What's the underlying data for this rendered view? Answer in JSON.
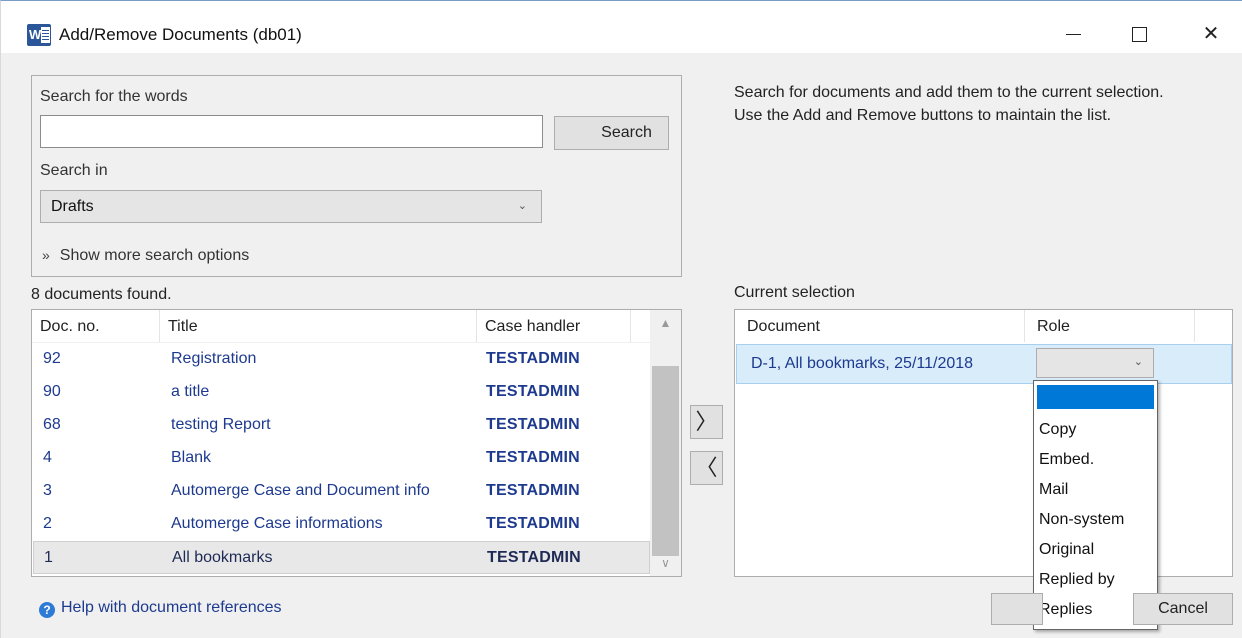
{
  "window": {
    "title": "Add/Remove Documents (db01)",
    "controls": {
      "minimize": "minimize",
      "maximize": "maximize",
      "close": "✕"
    }
  },
  "search": {
    "words_label": "Search for the words",
    "words_value": "",
    "search_button": "Search",
    "search_in_label": "Search in",
    "search_in_value": "Drafts",
    "more_options": "Show more search options"
  },
  "results": {
    "count_text": "8 documents found.",
    "columns": [
      "Doc. no.",
      "Title",
      "Case handler"
    ],
    "rows": [
      {
        "no": "92",
        "title": "Registration",
        "handler": "TESTADMIN"
      },
      {
        "no": "90",
        "title": "a title",
        "handler": "TESTADMIN"
      },
      {
        "no": "68",
        "title": "testing Report",
        "handler": "TESTADMIN"
      },
      {
        "no": "4",
        "title": "Blank",
        "handler": "TESTADMIN"
      },
      {
        "no": "3",
        "title": "Automerge Case and Document info",
        "handler": "TESTADMIN"
      },
      {
        "no": "2",
        "title": "Automerge Case informations",
        "handler": "TESTADMIN"
      },
      {
        "no": "1",
        "title": "All bookmarks",
        "handler": "TESTADMIN",
        "selected": true
      }
    ]
  },
  "transfer": {
    "add": "〉",
    "remove": "〈"
  },
  "info_text": {
    "line1": "Search for documents and add them to the current selection.",
    "line2": "Use the Add and Remove buttons to maintain the list."
  },
  "selection": {
    "label": "Current selection",
    "columns": [
      "Document",
      "Role"
    ],
    "rows": [
      {
        "document": "D-1, All bookmarks, 25/11/2018",
        "role": ""
      }
    ]
  },
  "role_dropdown": {
    "options": [
      "",
      "Copy",
      "Embed.",
      "Mail",
      "Non-system",
      "Original",
      "Replied by",
      "Replies"
    ]
  },
  "footer": {
    "help_link": "Help with document references",
    "ok_button": "",
    "cancel_button": "Cancel"
  },
  "colors": {
    "accent": "#0078d7",
    "link": "#1d3a8f",
    "selected_row": "#d9ecfa"
  }
}
